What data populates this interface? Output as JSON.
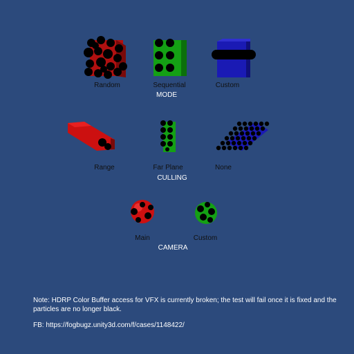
{
  "sections": {
    "mode": {
      "title": "MODE",
      "items": [
        "Random",
        "Sequential",
        "Custom"
      ]
    },
    "culling": {
      "title": "CULLING",
      "items": [
        "Range",
        "Far Plane",
        "None"
      ]
    },
    "camera": {
      "title": "CAMERA",
      "items": [
        "Main",
        "Custom"
      ]
    }
  },
  "note": "Note: HDRP Color Buffer access for VFX is currently broken; the test will fail once it is fixed and the particles are no longer black.",
  "fb": "FB: https://fogbugz.unity3d.com/f/cases/1148422/",
  "colors": {
    "background": "#2c4a7c",
    "red": "#cc1010",
    "green": "#14a014",
    "blue": "#1a1ab4",
    "particle": "#000000"
  }
}
